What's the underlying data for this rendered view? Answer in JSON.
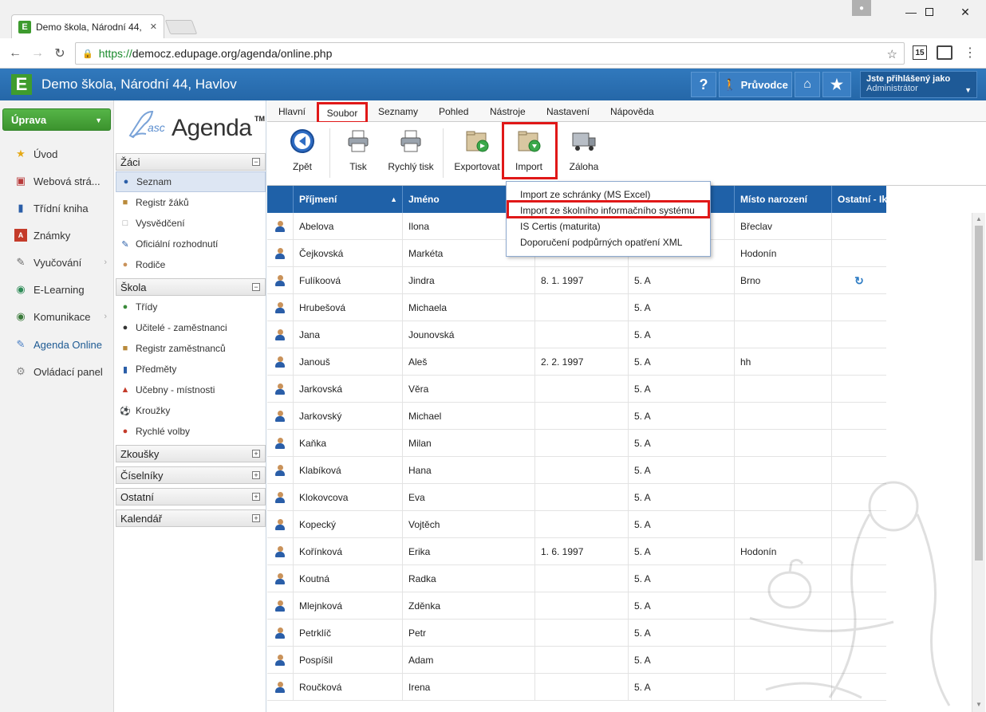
{
  "browser": {
    "tab_title": "Demo škola, Národní 44,",
    "tab_close": "✕",
    "url_secure": "https://",
    "url_rest": "democz.edupage.org/agenda/online.php",
    "ext_badge": "15"
  },
  "header": {
    "school_title": "Demo škola, Národní 44, Havlov",
    "logo_letter": "E",
    "help_label": "?",
    "guide_label": "Průvodce",
    "user_line1": "Jste přihlášený jako",
    "user_line2": "Administrátor"
  },
  "main_menu": {
    "primary_button": "Úprava",
    "items": [
      {
        "label": "Úvod",
        "icon": "star-icon"
      },
      {
        "label": "Webová strá...",
        "icon": "web-icon"
      },
      {
        "label": "Třídní kniha",
        "icon": "book-icon"
      },
      {
        "label": "Známky",
        "icon": "grades-icon"
      },
      {
        "label": "Vyučování",
        "icon": "teaching-icon"
      },
      {
        "label": "E-Learning",
        "icon": "elearning-icon"
      },
      {
        "label": "Komunikace",
        "icon": "communication-icon"
      },
      {
        "label": "Agenda Online",
        "icon": "agenda-icon"
      },
      {
        "label": "Ovládací panel",
        "icon": "control-panel-icon"
      }
    ]
  },
  "sidebar": {
    "logo_asc": "asc",
    "logo_agenda": "Agenda",
    "logo_tm": "TM",
    "sections": [
      {
        "title": "Žáci",
        "toggle": "−",
        "items": [
          "Seznam",
          "Registr žáků",
          "Vysvědčení",
          "Oficiální rozhodnutí",
          "Rodiče"
        ]
      },
      {
        "title": "Škola",
        "toggle": "−",
        "items": [
          "Třídy",
          "Učitelé - zaměstnanci",
          "Registr zaměstnanců",
          "Předměty",
          "Učebny - místnosti",
          "Kroužky",
          "Rychlé volby"
        ]
      },
      {
        "title": "Zkoušky",
        "toggle": "+"
      },
      {
        "title": "Číselníky",
        "toggle": "+"
      },
      {
        "title": "Ostatní",
        "toggle": "+"
      },
      {
        "title": "Kalendář",
        "toggle": "+"
      }
    ]
  },
  "ribbon": {
    "tabs": [
      "Hlavní",
      "Soubor",
      "Seznamy",
      "Pohled",
      "Nástroje",
      "Nastavení",
      "Nápověda"
    ],
    "buttons": {
      "back": "Zpět",
      "print": "Tisk",
      "quick_print": "Rychlý tisk",
      "export": "Exportovat",
      "import": "Import",
      "backup": "Záloha"
    }
  },
  "dropdown": {
    "items": [
      "Import ze schránky (MS Excel)",
      "Import ze školního informačního systému",
      "IS Certis (maturita)",
      "Doporučení podpůrných opatření XML"
    ]
  },
  "table": {
    "columns": [
      "Příjmení",
      "Jméno",
      "",
      "",
      "Místo narození",
      "Ostatní - Ik"
    ],
    "rows": [
      [
        "Abelova",
        "Ilona",
        "",
        "",
        "Břeclav",
        ""
      ],
      [
        "Čejkovská",
        "Markéta",
        "",
        "",
        "Hodonín",
        ""
      ],
      [
        "Fulíkoová",
        "Jindra",
        "8. 1. 1997",
        "5. A",
        "Brno",
        "sync"
      ],
      [
        "Hrubešová",
        "Michaela",
        "",
        "5. A",
        "",
        ""
      ],
      [
        "Jana",
        "Jounovská",
        "",
        "5. A",
        "",
        ""
      ],
      [
        "Janouš",
        "Aleš",
        "2. 2. 1997",
        "5. A",
        "hh",
        ""
      ],
      [
        "Jarkovská",
        "Věra",
        "",
        "5. A",
        "",
        ""
      ],
      [
        "Jarkovský",
        "Michael",
        "",
        "5. A",
        "",
        ""
      ],
      [
        "Kaňka",
        "Milan",
        "",
        "5. A",
        "",
        ""
      ],
      [
        "Klabíková",
        "Hana",
        "",
        "5. A",
        "",
        ""
      ],
      [
        "Klokovcova",
        "Eva",
        "",
        "5. A",
        "",
        ""
      ],
      [
        "Kopecký",
        "Vojtěch",
        "",
        "5. A",
        "",
        ""
      ],
      [
        "Kořínková",
        "Erika",
        "1. 6. 1997",
        "5. A",
        "Hodonín",
        ""
      ],
      [
        "Koutná",
        "Radka",
        "",
        "5. A",
        "",
        ""
      ],
      [
        "Mlejnková",
        "Zděnka",
        "",
        "5. A",
        "",
        ""
      ],
      [
        "Petrklíč",
        "Petr",
        "",
        "5. A",
        "",
        ""
      ],
      [
        "Pospíšil",
        "Adam",
        "",
        "5. A",
        "",
        ""
      ],
      [
        "Roučková",
        "Irena",
        "",
        "5. A",
        "",
        ""
      ]
    ]
  },
  "colors": {
    "header_blue": "#2567a8",
    "grid_header": "#1f61a8",
    "highlight_red": "#e01818",
    "primary_green": "#49a23c"
  }
}
